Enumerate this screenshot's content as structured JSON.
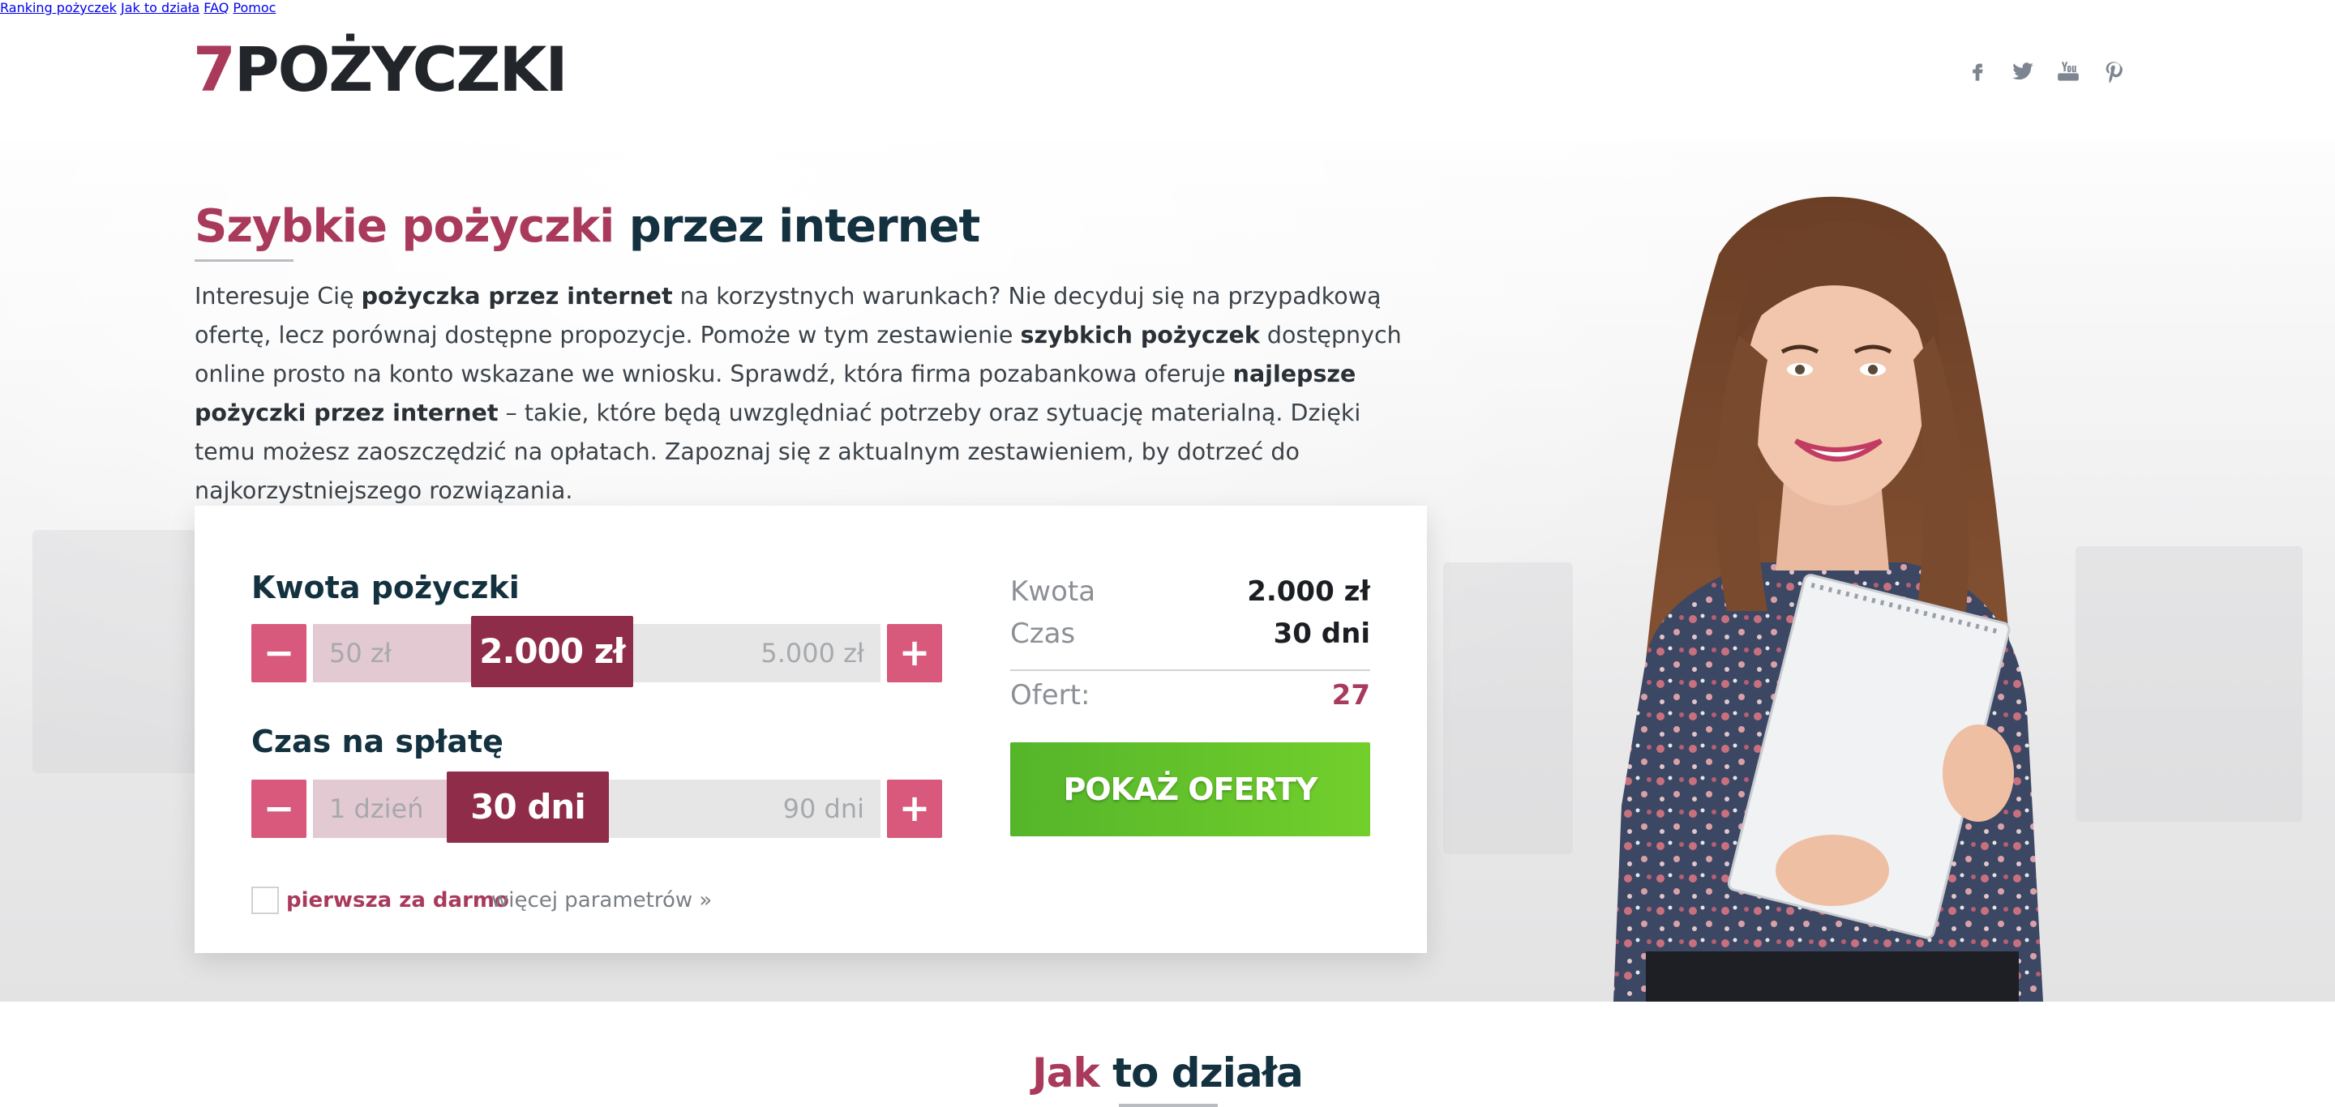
{
  "header": {
    "logo_number": "7",
    "logo_text": "POŻYCZKI",
    "nav": [
      {
        "label": "Ranking pożyczek"
      },
      {
        "label": "Jak to działa"
      },
      {
        "label": "FAQ"
      },
      {
        "label": "Pomoc"
      }
    ],
    "social": [
      "facebook-icon",
      "twitter-icon",
      "youtube-icon",
      "pinterest-icon"
    ]
  },
  "hero": {
    "title_accent": "Szybkie pożyczki",
    "title_rest": " przez internet",
    "intro_parts": [
      {
        "t": "Interesuje Cię ",
        "b": false
      },
      {
        "t": "pożyczka przez internet",
        "b": true
      },
      {
        "t": " na korzystnych warunkach? Nie decyduj się na przypadkową ofertę, lecz porównaj dostępne propozycje. Pomoże w tym zestawienie ",
        "b": false
      },
      {
        "t": "szybkich pożyczek",
        "b": true
      },
      {
        "t": " dostępnych online prosto na konto wskazane we wniosku. Sprawdź, która firma pozabankowa oferuje ",
        "b": false
      },
      {
        "t": "najlepsze pożyczki przez internet",
        "b": true
      },
      {
        "t": " – takie, które będą uwzględniać potrzeby oraz sytuację materialną. Dzięki temu możesz zaoszczędzić na opłatach. Zapoznaj się z aktualnym zestawieniem, by dotrzeć do najkorzystniejszego rozwiązania.",
        "b": false
      }
    ]
  },
  "calculator": {
    "amount": {
      "label": "Kwota pożyczki",
      "min": "50 zł",
      "max": "5.000 zł",
      "value": "2.000 zł",
      "position": 0.39,
      "minus": "−",
      "plus": "+"
    },
    "term": {
      "label": "Czas na spłatę",
      "min": "1 dzień",
      "max": "90 dni",
      "value": "30 dni",
      "position": 0.33,
      "minus": "−",
      "plus": "+"
    },
    "checkbox_label": "pierwsza za darmo",
    "checkbox_checked": false,
    "more_params": "więcej parametrów »",
    "summary": {
      "amount_key": "Kwota",
      "amount_value": "2.000 zł",
      "time_key": "Czas",
      "time_value": "30 dni",
      "offers_key": "Ofert:",
      "offers_value": "27"
    },
    "cta_label": "POKAŻ OFERTY"
  },
  "section2": {
    "title_accent": "Jak",
    "title_rest": " to działa"
  },
  "colors": {
    "accent": "#a93a5c",
    "dark": "#13313f",
    "button_pink": "#d8597c",
    "handle": "#8f2c4a",
    "cta_green": "#5cbd2b"
  }
}
